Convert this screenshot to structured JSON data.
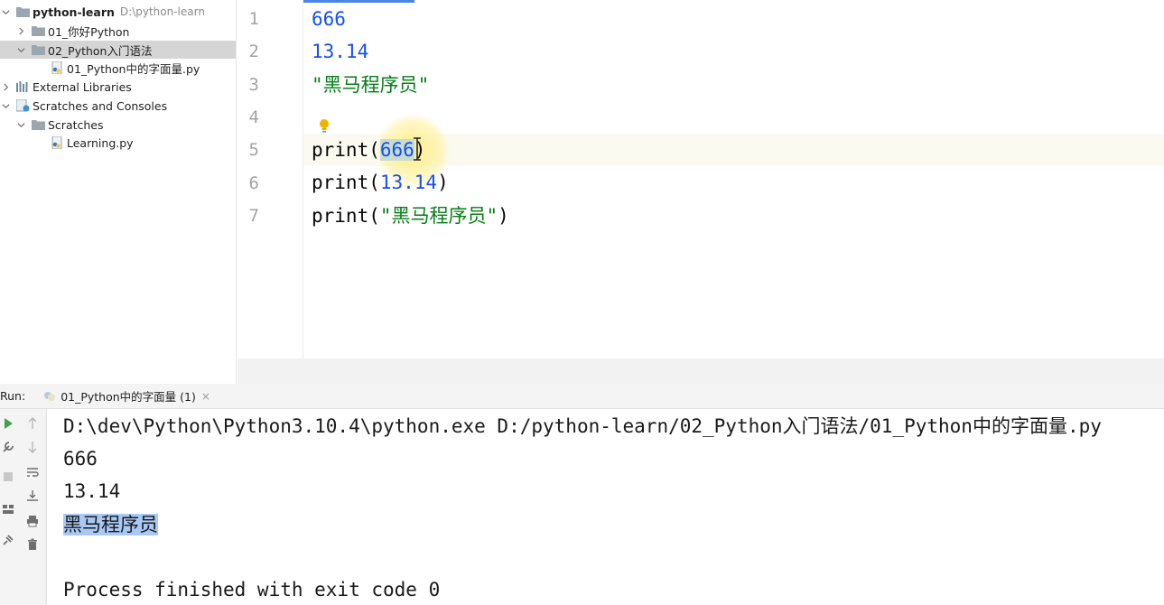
{
  "project_tree": {
    "root": {
      "name": "python-learn",
      "path": "D:\\python-learn"
    },
    "items": [
      {
        "label": "01_你好Python"
      },
      {
        "label": "02_Python入门语法"
      },
      {
        "label": "01_Python中的字面量.py"
      },
      {
        "label": "External Libraries"
      },
      {
        "label": "Scratches and Consoles"
      },
      {
        "label": "Scratches"
      },
      {
        "label": "Learning.py"
      }
    ]
  },
  "editor": {
    "line_numbers": [
      "1",
      "2",
      "3",
      "4",
      "5",
      "6",
      "7"
    ],
    "lines": {
      "l1": "666",
      "l2": "13.14",
      "l3": "\"黑马程序员\"",
      "l5_fn": "print(",
      "l5_arg": "666",
      "l5_end": ")",
      "l6_fn": "print(",
      "l6_arg": "13.14",
      "l6_end": ")",
      "l7_fn": "print(",
      "l7_arg": "\"黑马程序员\"",
      "l7_end": ")"
    }
  },
  "run_panel": {
    "label": "Run:",
    "tab_label": "01_Python中的字面量 (1)",
    "close_glyph": "×",
    "output": [
      "D:\\dev\\Python\\Python3.10.4\\python.exe D:/python-learn/02_Python入门语法/01_Python中的字面量.py",
      "666",
      "13.14",
      "黑马程序员",
      "",
      "Process finished with exit code 0"
    ]
  },
  "colors": {
    "number": "#1750eb",
    "string": "#067d17",
    "selection": "#a9c9f5",
    "accent": "#4a86e8"
  },
  "icons": [
    "folder-icon",
    "python-file-icon",
    "libraries-icon",
    "scratches-icon",
    "bulb-icon",
    "run-icon",
    "wrench-icon",
    "stop-icon",
    "layout-icon",
    "pin-icon",
    "up-arrow-icon",
    "down-arrow-icon",
    "soft-wrap-icon",
    "scroll-to-end-icon",
    "print-icon",
    "trash-icon"
  ]
}
